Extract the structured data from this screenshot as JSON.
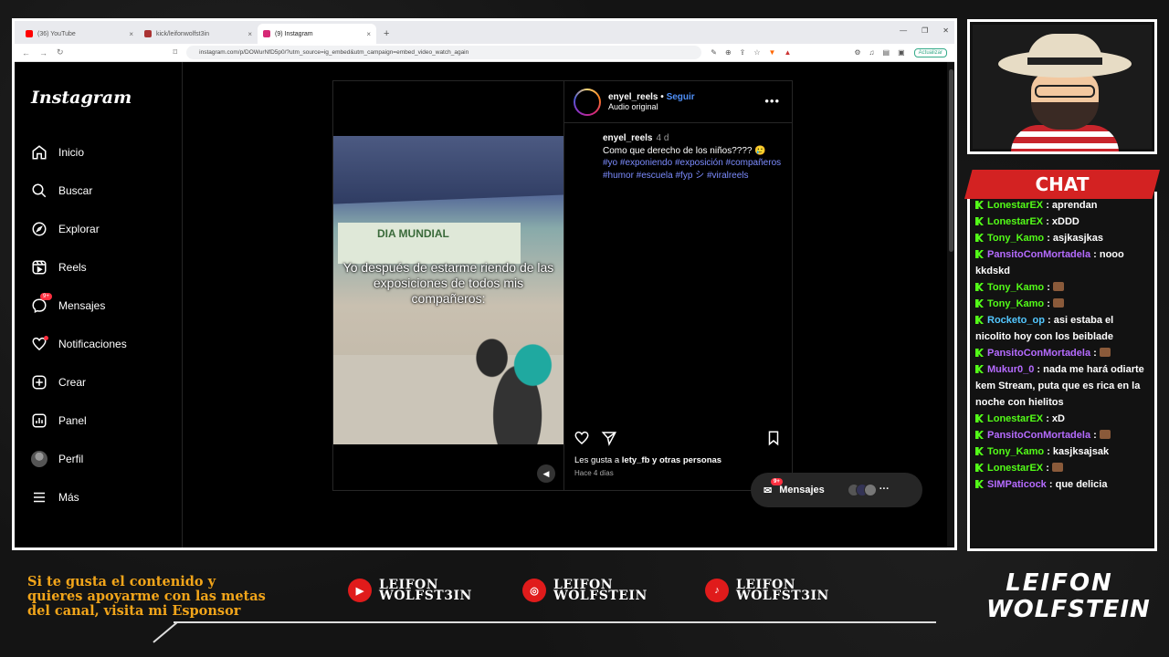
{
  "browser": {
    "tabs": [
      {
        "label": "(36) YouTube",
        "color": "#ff0000"
      },
      {
        "label": "kick/leifonwolfst3in",
        "color": "#53fc18"
      },
      {
        "label": "(9) Instagram",
        "color": "#d62976"
      }
    ],
    "url": "instagram.com/p/DOWurNfD5p0/?utm_source=ig_embed&utm_campaign=embed_video_watch_again",
    "update_label": "Actualizar"
  },
  "instagram": {
    "logo": "Instagram",
    "nav": [
      {
        "label": "Inicio",
        "icon": "home-icon"
      },
      {
        "label": "Buscar",
        "icon": "search-icon"
      },
      {
        "label": "Explorar",
        "icon": "compass-icon"
      },
      {
        "label": "Reels",
        "icon": "reels-icon"
      },
      {
        "label": "Mensajes",
        "icon": "messenger-icon",
        "badge": "9+"
      },
      {
        "label": "Notificaciones",
        "icon": "heart-icon"
      },
      {
        "label": "Crear",
        "icon": "plus-icon"
      },
      {
        "label": "Panel",
        "icon": "chart-icon"
      },
      {
        "label": "Perfil",
        "icon": "avatar"
      },
      {
        "label": "Más",
        "icon": "menu-icon"
      }
    ],
    "post": {
      "username": "enyel_reels",
      "follow": "Seguir",
      "audio": "Audio original",
      "caption_user": "enyel_reels",
      "caption_time": "4 d",
      "caption_text": "Como que derecho de los niños???? 🥲",
      "hashtags": "#yo #exponiendo #exposición #compañeros #humor #escuela #fyp シ #viralreels",
      "video_overlay": "Yo después de estarme riendo de las exposiciones de todos mis compañeros:",
      "video_banner": "DIA MUNDIAL",
      "likes_prefix": "Les gusta a ",
      "likes_user": "lety_fb",
      "likes_suffix": " y otras personas",
      "ago": "Hace 4 días"
    },
    "messages_pill": {
      "label": "Mensajes",
      "badge": "9+"
    }
  },
  "chat": {
    "title": "CHAT",
    "messages": [
      {
        "user": "LonestarEX",
        "color": "green",
        "text": "aprendan"
      },
      {
        "user": "LonestarEX",
        "color": "green",
        "text": "xDDD"
      },
      {
        "user": "Tony_Kamo",
        "color": "green",
        "text": "asjkasjkas"
      },
      {
        "user": "PansitoConMortadela",
        "color": "purple",
        "text": "nooo kkdskd"
      },
      {
        "user": "Tony_Kamo",
        "color": "green",
        "text": "[emote]"
      },
      {
        "user": "Tony_Kamo",
        "color": "green",
        "text": "[emote]"
      },
      {
        "user": "Rocketo_op",
        "color": "blue",
        "text": "asi estaba el nicolito hoy con los beiblade"
      },
      {
        "user": "PansitoConMortadela",
        "color": "purple",
        "text": "[emote]"
      },
      {
        "user": "Mukur0_0",
        "color": "purple",
        "text": "nada me hará odiarte kem Stream, puta que es rica en la noche con hielitos"
      },
      {
        "user": "LonestarEX",
        "color": "green",
        "text": "xD"
      },
      {
        "user": "PansitoConMortadela",
        "color": "purple",
        "text": "[emote]"
      },
      {
        "user": "Tony_Kamo",
        "color": "green",
        "text": "kasjksajsak"
      },
      {
        "user": "LonestarEX",
        "color": "green",
        "text": "[emote]"
      },
      {
        "user": "SIMPaticock",
        "color": "purple",
        "text": "que delicia"
      }
    ]
  },
  "footer": {
    "sponsor": "Si te gusta el contenido y quieres apoyarme con las metas del canal, visita mi Esponsor",
    "socials": [
      {
        "icon": "youtube-icon",
        "line1": "LEIFON",
        "line2": "WOLFST3IN"
      },
      {
        "icon": "instagram-icon",
        "line1": "LEIFON",
        "line2": "WOLFSTEIN"
      },
      {
        "icon": "tiktok-icon",
        "line1": "LEIFON",
        "line2": "WOLFST3IN"
      }
    ],
    "brand_line1": "LEIFON",
    "brand_line2": "WOLFSTEIN"
  }
}
